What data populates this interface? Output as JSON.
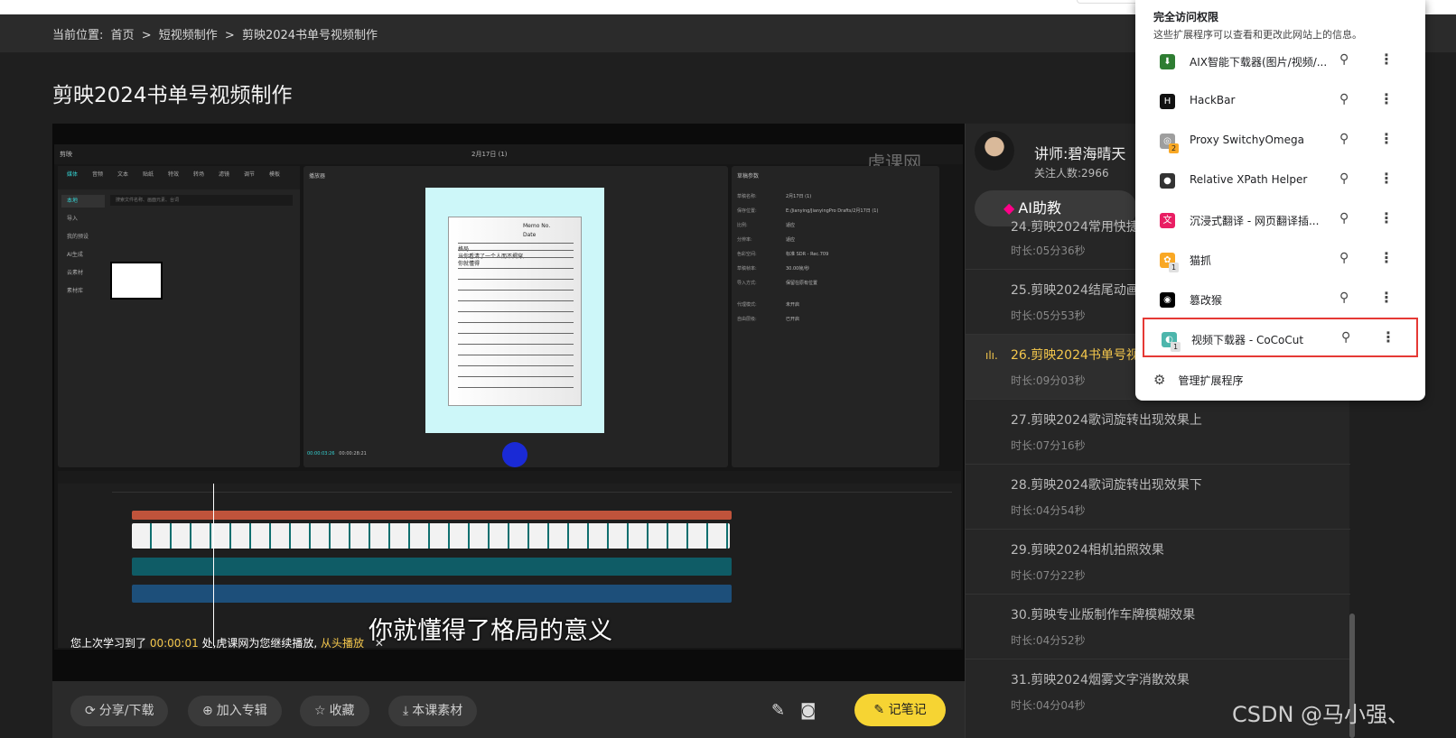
{
  "breadcrumb": {
    "prefix": "当前位置:",
    "items": [
      "首页",
      "短视频制作",
      "剪映2024书单号视频制作"
    ],
    "separator": ">"
  },
  "page_title": "剪映2024书单号视频制作",
  "video": {
    "editor_logo": "剪映",
    "editor_date": "2月17日 (1)",
    "watermark": "虎课网",
    "player_title": "播放器",
    "props_title": "草稿参数",
    "media_tools": [
      "媒体",
      "音频",
      "文本",
      "贴纸",
      "特效",
      "转场",
      "滤镜",
      "调节",
      "模板"
    ],
    "media_side": [
      "本地",
      "导入",
      "我的预设",
      "AI生成",
      "云素材",
      "素材库"
    ],
    "media_search": "搜索文件名称、画面元素、台词",
    "paper_memo": "Memo No.",
    "paper_date": "Date",
    "paper_lines": [
      "格局",
      "当你看清了一个人而不揭穿,",
      "你就懂得"
    ],
    "time_current": "00:00:03:26",
    "time_total": "00:00:28:21",
    "props_rows": [
      {
        "k": "草稿名称:",
        "v": "2月17日 (1)"
      },
      {
        "k": "保存位置:",
        "v": "E:/Jianying/JianyingPro Drafts/2月17日 (1)"
      },
      {
        "k": "比例:",
        "v": "适应"
      },
      {
        "k": "分辨率:",
        "v": "适应"
      },
      {
        "k": "色彩空间:",
        "v": "标准 SDR - Rec.709"
      },
      {
        "k": "草稿帧率:",
        "v": "30.00帧/秒"
      },
      {
        "k": "导入方式:",
        "v": "保留在原有位置"
      },
      {
        "k": "代理模式:",
        "v": "未开启"
      },
      {
        "k": "自由层级:",
        "v": "已开启"
      }
    ],
    "subtitle": "你就懂得了格局的意义",
    "resume": {
      "pre": "您上次学习到了",
      "time": "00:00:01",
      "mid": "处,虎课网为您继续播放,",
      "link": "从头播放",
      "close": "✕"
    }
  },
  "actions": {
    "share": "分享/下载",
    "add_album": "加入专辑",
    "favorite": "收藏",
    "materials": "本课素材",
    "note": "记笔记"
  },
  "teacher": {
    "name": "讲师:碧海晴天",
    "fans": "关注人数:2966"
  },
  "ai_button": "AI助教",
  "lessons": [
    {
      "title": "24.剪映2024常用快捷",
      "duration": "时长:05分36秒",
      "active": false
    },
    {
      "title": "25.剪映2024结尾动画",
      "duration": "时长:05分53秒",
      "active": false
    },
    {
      "title": "26.剪映2024书单号视",
      "duration": "时长:09分03秒",
      "active": true
    },
    {
      "title": "27.剪映2024歌词旋转出现效果上",
      "duration": "时长:07分16秒",
      "active": false
    },
    {
      "title": "28.剪映2024歌词旋转出现效果下",
      "duration": "时长:04分54秒",
      "active": false
    },
    {
      "title": "29.剪映2024相机拍照效果",
      "duration": "时长:07分22秒",
      "active": false
    },
    {
      "title": "30.剪映专业版制作车牌模糊效果",
      "duration": "时长:04分52秒",
      "active": false
    },
    {
      "title": "31.剪映2024烟雾文字消散效果",
      "duration": "时长:04分04秒",
      "active": false
    }
  ],
  "extensions_popup": {
    "heading": "完全访问权限",
    "subheading": "这些扩展程序可以查看和更改此网站上的信息。",
    "items": [
      {
        "name": "AIX智能下载器(图片/视频/...",
        "icon_bg": "#2e7d32",
        "icon_glyph": "⬇",
        "badge": ""
      },
      {
        "name": "HackBar",
        "icon_bg": "#111111",
        "icon_glyph": "H",
        "badge": ""
      },
      {
        "name": "Proxy SwitchyOmega",
        "icon_bg": "#9e9e9e",
        "icon_glyph": "◎",
        "badge": "2"
      },
      {
        "name": "Relative XPath Helper",
        "icon_bg": "#333333",
        "icon_glyph": "●",
        "badge": ""
      },
      {
        "name": "沉浸式翻译 - 网页翻译插...",
        "icon_bg": "#e91e63",
        "icon_glyph": "文",
        "badge": ""
      },
      {
        "name": "猫抓",
        "icon_bg": "#f9a825",
        "icon_glyph": "🐾",
        "badge": "1"
      },
      {
        "name": "篡改猴",
        "icon_bg": "#000000",
        "icon_glyph": "◉",
        "badge": ""
      },
      {
        "name": "视频下载器 - CoCoCut",
        "icon_bg": "#4db6ac",
        "icon_glyph": "◐",
        "badge": "1"
      }
    ],
    "manage": "管理扩展程序"
  },
  "watermark_csdn": "CSDN @马小强、"
}
